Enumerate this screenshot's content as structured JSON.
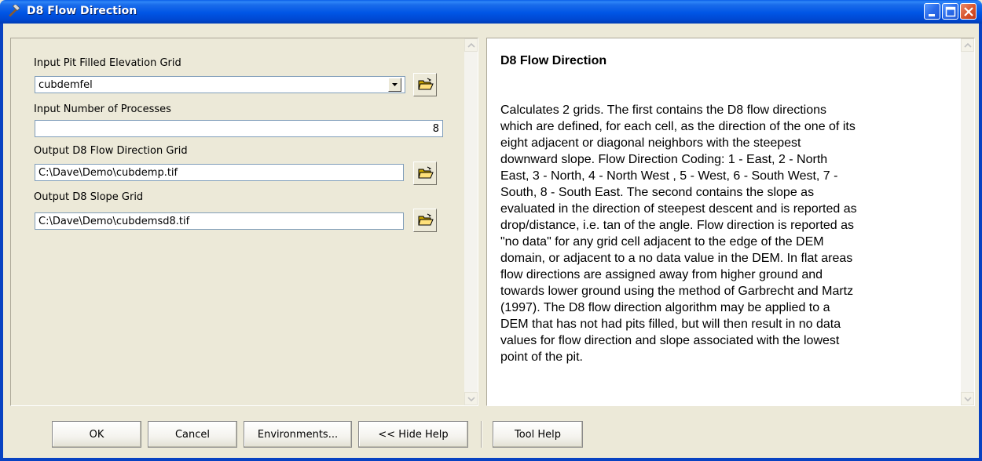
{
  "window": {
    "title": "D8 Flow Direction"
  },
  "form": {
    "pit_filled_label": "Input Pit Filled Elevation Grid",
    "pit_filled_value": "cubdemfel",
    "processes_label": "Input Number of Processes",
    "processes_value": "8",
    "flow_dir_label": "Output D8 Flow Direction Grid",
    "flow_dir_value": "C:\\Dave\\Demo\\cubdemp.tif",
    "slope_label": "Output D8 Slope Grid",
    "slope_value": "C:\\Dave\\Demo\\cubdemsd8.tif"
  },
  "help": {
    "title": "D8 Flow Direction",
    "lines": [
      "Calculates 2 grids. The first contains the D8 flow directions",
      "which are defined, for each cell, as the direction of the one of its",
      "eight adjacent or diagonal neighbors with the steepest",
      "downward slope. Flow Direction Coding: 1 - East, 2 - North",
      "East, 3 - North, 4 - North West , 5 - West, 6 - South West, 7 -",
      "South, 8 - South East. The second contains the slope as",
      "evaluated in the direction of steepest descent and is reported as",
      "drop/distance, i.e. tan of the angle. Flow direction is reported as",
      "\"no data\" for any grid cell adjacent to the edge of the DEM",
      "domain, or adjacent to a no data value in the DEM. In flat areas",
      "flow directions are assigned away from higher ground and",
      "towards lower ground using the method of Garbrecht and Martz",
      "(1997). The D8 flow direction algorithm may be applied to a",
      "DEM that has not had pits filled, but will then result in no data",
      "values for flow direction and slope associated with the lowest",
      "point of the pit."
    ]
  },
  "buttons": {
    "ok": "OK",
    "cancel": "Cancel",
    "environments": "Environments...",
    "hide_help": "<< Hide Help",
    "tool_help": "Tool Help"
  },
  "icons": {
    "title": "hammer-icon",
    "browse": "open-folder-icon",
    "dropdown": "chevron-down-icon"
  },
  "colors": {
    "titlebar": "#0055E5",
    "dialog_bg": "#ECE9D8",
    "close_button": "#D9542B"
  }
}
